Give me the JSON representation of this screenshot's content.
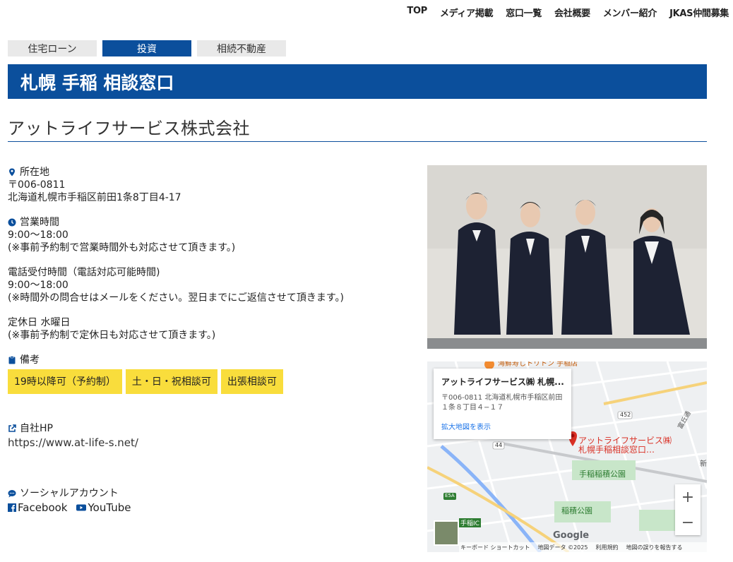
{
  "nav": [
    "TOP",
    "メディア掲載",
    "窓口一覧",
    "会社概要",
    "メンバー紹介",
    "JKAS仲間募集"
  ],
  "tabs": [
    "住宅ローン",
    "投資",
    "相続不動産"
  ],
  "banner": "札幌 手稲 相談窓口",
  "company": "アットライフサービス株式会社",
  "location": {
    "label": "所在地",
    "zip": "〒006-0811",
    "address": "北海道札幌市手稲区前田1条8丁目4-17"
  },
  "hours": {
    "label": "営業時間",
    "time": "9:00～18:00",
    "note": "(※事前予約制で営業時間外も対応させて頂きます。)"
  },
  "phone": {
    "label": "電話受付時間（電話対応可能時間)",
    "time": "9:00～18:00",
    "note": "(※時間外の問合せはメールをください。翌日までにご返信させて頂きます。)"
  },
  "holiday": {
    "label": "定休日 水曜日",
    "note": "(※事前予約制で定休日も対応させて頂きます。)"
  },
  "remarks": {
    "label": "備考",
    "tags": [
      "19時以降可（予約制）",
      "土・日・祝相談可",
      "出張相談可"
    ]
  },
  "website": {
    "label": "自社HP",
    "url": "https://www.at-life-s.net/"
  },
  "social": {
    "label": "ソーシャルアカウント",
    "facebook": "Facebook",
    "youtube": "YouTube"
  },
  "map": {
    "card_title": "アットライフサービス㈱ 札幌...",
    "card_address": "〒006-0811 北海道札幌市手稲区前田１条８丁目４−１７",
    "card_link": "拡大地図を表示",
    "pin_label_1": "アットライフサービス㈱",
    "pin_label_2": "札幌手稲相談窓口…",
    "park1": "手稲稲積公園",
    "park2": "稲積公園",
    "station": "手稲IC",
    "route1": "452",
    "route2": "44",
    "route3": "E5A",
    "road": "富丘通",
    "top_poi": "海鮮寿しトリトン 手稲店",
    "shin": "新",
    "google": "Google",
    "zoom_in": "+",
    "zoom_out": "−",
    "attribution": [
      "キーボード ショートカット",
      "地図データ ©2025",
      "利用規約",
      "地図の誤りを報告する"
    ]
  },
  "colors": {
    "primary": "#0b4f9c",
    "tag": "#f9dd3c",
    "map_link": "#1a73e8",
    "pin": "#d93025"
  }
}
